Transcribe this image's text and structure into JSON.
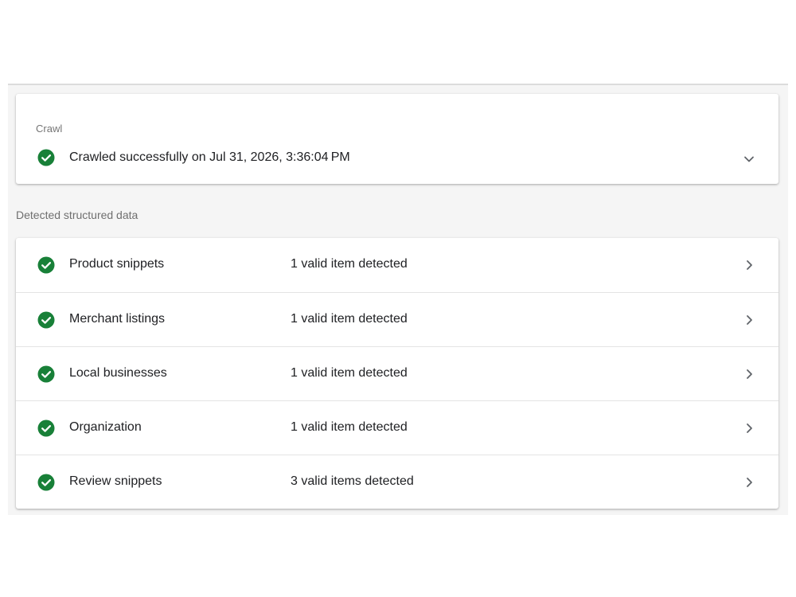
{
  "crawl": {
    "heading": "Crawl",
    "status": "Crawled successfully on Jul 31, 2026, 3:36:04 PM"
  },
  "structured_data": {
    "heading": "Detected structured data",
    "items": [
      {
        "name": "Product snippets",
        "status": "1 valid item detected"
      },
      {
        "name": "Merchant listings",
        "status": "1 valid item detected"
      },
      {
        "name": "Local businesses",
        "status": "1 valid item detected"
      },
      {
        "name": "Organization",
        "status": "1 valid item detected"
      },
      {
        "name": "Review snippets",
        "status": "3 valid items detected"
      }
    ]
  },
  "colors": {
    "success": "#188038",
    "icon_gray": "#5f6368"
  },
  "icons": {
    "status": "check-circle-icon",
    "expand": "chevron-down-icon",
    "open": "chevron-right-icon"
  }
}
